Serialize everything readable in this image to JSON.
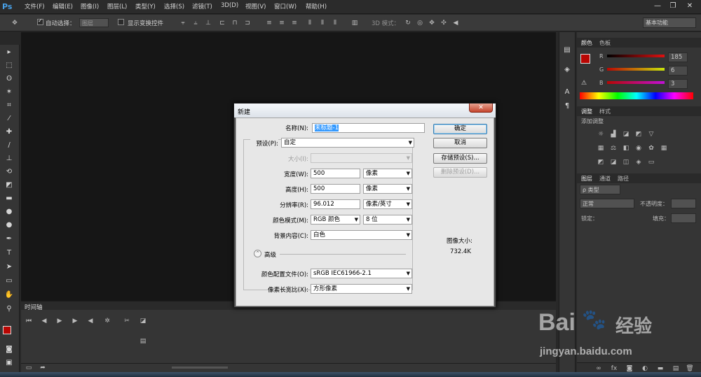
{
  "app": {
    "logo": "Ps"
  },
  "menu": [
    "文件(F)",
    "编辑(E)",
    "图像(I)",
    "图层(L)",
    "类型(Y)",
    "选择(S)",
    "滤镜(T)",
    "3D(D)",
    "视图(V)",
    "窗口(W)",
    "帮助(H)"
  ],
  "window_controls": {
    "minimize": "—",
    "restore": "❐",
    "close": "✕"
  },
  "options": {
    "auto_select_label": "自动选择：",
    "auto_select_value": "图层",
    "show_transform_label": "显示变换控件",
    "mode_3d_label": "3D 模式：",
    "workspace": "基本功能"
  },
  "timeline": {
    "title": "时间轴"
  },
  "panels": {
    "color_tabs": [
      "颜色",
      "色板"
    ],
    "rgb": {
      "r_label": "R",
      "r": "185",
      "g_label": "G",
      "g": "6",
      "b_label": "B",
      "b": "3"
    },
    "adjust_tabs": [
      "调整",
      "样式"
    ],
    "adjust_title": "添加调整",
    "layers_tabs": [
      "图层",
      "通道",
      "路径"
    ],
    "layers_filter": "ρ 类型",
    "blend_mode": "正常",
    "opacity_label": "不透明度：",
    "lock_label": "锁定：",
    "fill_label": "填充："
  },
  "dialog": {
    "title": "新建",
    "name_label": "名称(N):",
    "name_value": "未标题-1",
    "preset_label": "预设(P):",
    "preset_value": "自定",
    "size_label": "大小(I):",
    "width_label": "宽度(W):",
    "width_value": "500",
    "width_unit": "像素",
    "height_label": "高度(H):",
    "height_value": "500",
    "height_unit": "像素",
    "resolution_label": "分辨率(R):",
    "resolution_value": "96.012",
    "resolution_unit": "像素/英寸",
    "color_mode_label": "颜色模式(M):",
    "color_mode_value": "RGB 颜色",
    "bit_depth": "8 位",
    "background_label": "背景内容(C):",
    "background_value": "白色",
    "advanced_label": "高级",
    "color_profile_label": "颜色配置文件(O):",
    "color_profile_value": "sRGB IEC61966-2.1",
    "pixel_aspect_label": "像素长宽比(X):",
    "pixel_aspect_value": "方形像素",
    "ok": "确定",
    "cancel": "取消",
    "save_preset": "存储预设(S)...",
    "delete_preset": "删除预设(D)...",
    "image_size_label": "图像大小:",
    "image_size_value": "732.4K"
  },
  "watermark": {
    "brand": "Bai",
    "brand2": "经验",
    "url": "jingyan.baidu.com"
  },
  "colors": {
    "fg": "#b90603",
    "accent": "#3c7fb1",
    "brand_blue": "#48a1e8"
  }
}
